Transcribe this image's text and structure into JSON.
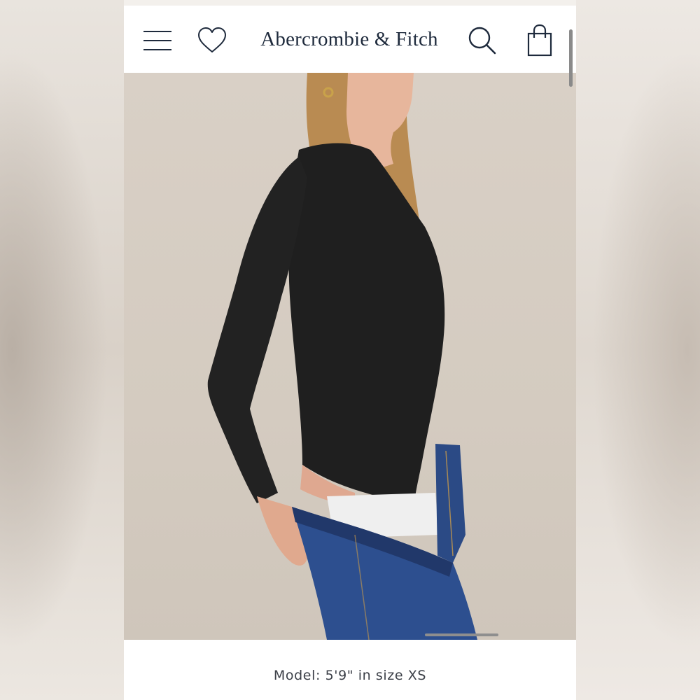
{
  "header": {
    "brand_name": "Abercrombie & Fitch",
    "icons": {
      "menu": "hamburger-menu-icon",
      "wishlist": "heart-icon",
      "search": "search-icon",
      "bag": "shopping-bag-icon"
    }
  },
  "product": {
    "image_description_icon": "product-photo",
    "model_caption": "Model: 5'9\" in size XS"
  },
  "colors": {
    "brand_navy": "#1e2a3c",
    "background": "#ffffff",
    "photo_backdrop": "#d6cdc2"
  }
}
